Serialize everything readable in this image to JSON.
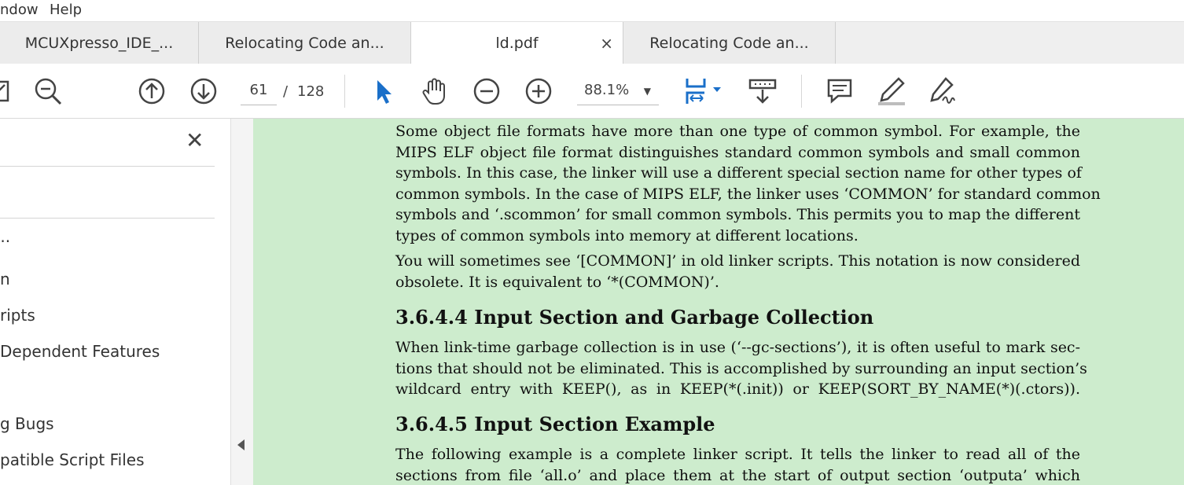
{
  "menubar": {
    "window": "ndow",
    "help": "Help"
  },
  "tabs": [
    {
      "label": "MCUXpresso_IDE_..."
    },
    {
      "label": "Relocating Code an..."
    },
    {
      "label": "ld.pdf",
      "close": "×"
    },
    {
      "label": "Relocating Code an..."
    }
  ],
  "toolbar": {
    "page_current": "61",
    "page_sep": "/",
    "page_total": "128",
    "zoom": "88.1%",
    "zoom_caret": "▼"
  },
  "left_pane": {
    "close": "✕",
    "items": [
      "...",
      "n",
      "ripts",
      "Dependent Features",
      "g Bugs",
      "patible Script Files"
    ]
  },
  "document": {
    "p1_lines": [
      "Some object file formats have more than one type of common symbol.  For example, the",
      "MIPS ELF object file format distinguishes standard common symbols and small common",
      "symbols. In this case, the linker will use a different special section name for other types of",
      "common symbols. In the case of MIPS ELF, the linker uses ‘COMMON’ for standard common",
      "symbols and ‘.scommon’ for small common symbols. This permits you to map the different",
      "types of common symbols into memory at different locations."
    ],
    "p2_lines": [
      "You will sometimes see ‘[COMMON]’ in old linker scripts.  This notation is now considered",
      "obsolete. It is equivalent to ‘*(COMMON)’."
    ],
    "h1": "3.6.4.4  Input Section and Garbage Collection",
    "p3_lines": [
      "When link-time garbage collection is in use (‘--gc-sections’), it is often useful to mark sec-",
      "tions that should not be eliminated. This is accomplished by surrounding an input section’s",
      "wildcard entry with KEEP(), as in KEEP(*(.init)) or KEEP(SORT_BY_NAME(*)(.ctors))."
    ],
    "h2": "3.6.4.5  Input Section Example",
    "p4_lines": [
      "The following example is a complete linker script.  It tells the linker to read all of the",
      "sections from file ‘all.o’ and place them at the start of output section ‘outputa’ which"
    ]
  }
}
